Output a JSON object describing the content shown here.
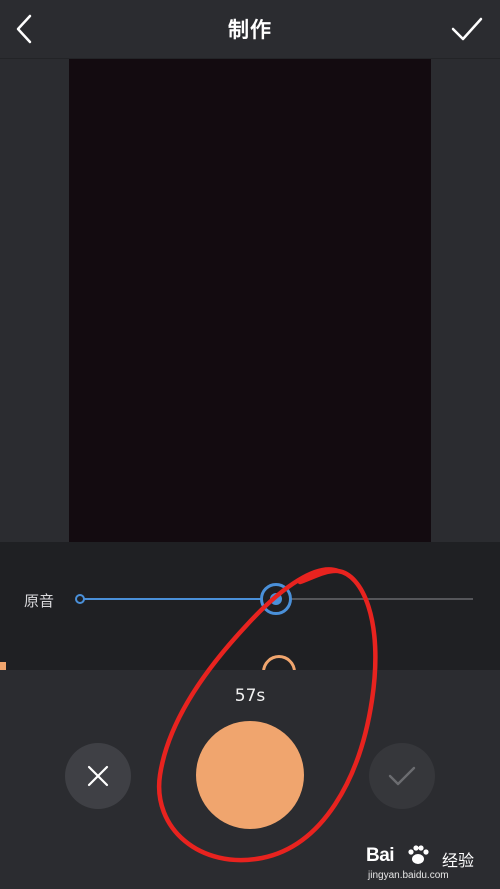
{
  "header": {
    "title": "制作"
  },
  "mixer": {
    "label": "原音",
    "level": 0.5
  },
  "recorder": {
    "timer": "57s"
  },
  "watermark": {
    "brand": "Bai",
    "brand_suffix": "经验",
    "url": "jingyan.baidu.com"
  },
  "colors": {
    "accent_blue": "#4a90d9",
    "record_orange": "#f0a56e",
    "annotation_red": "#e8231f"
  },
  "icons": {
    "back": "chevron-left-icon",
    "confirm": "checkmark-icon",
    "cancel": "close-icon",
    "done": "checkmark-icon"
  }
}
